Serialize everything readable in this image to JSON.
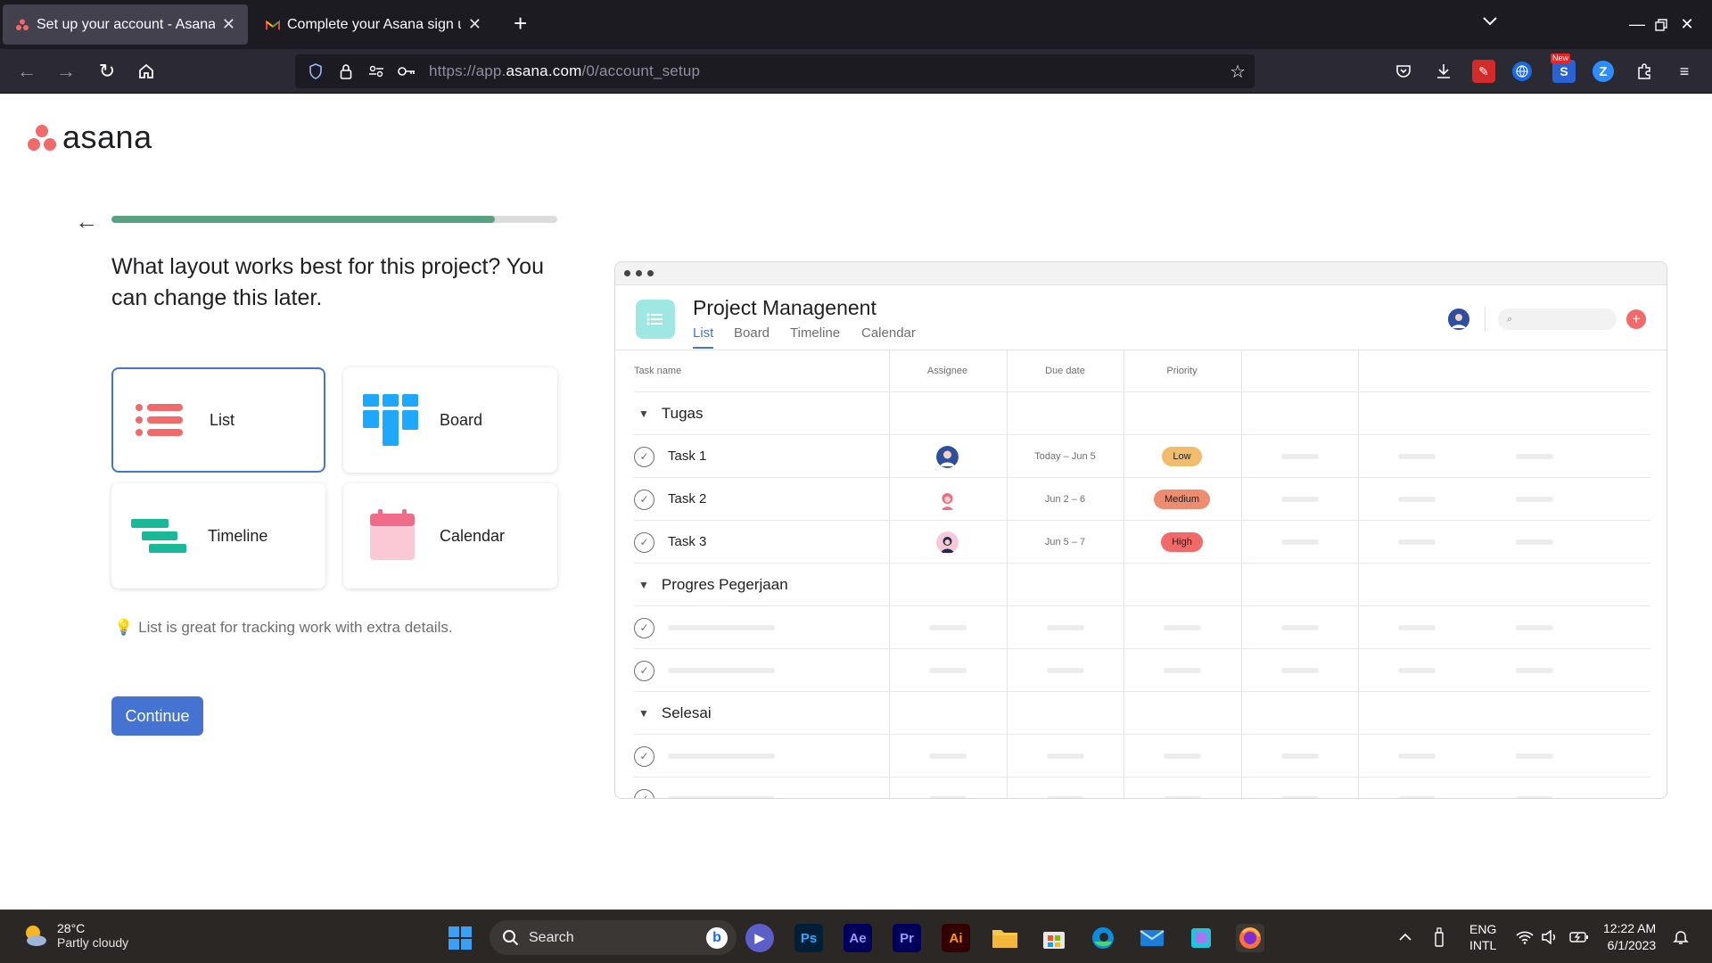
{
  "browser": {
    "tabs": [
      {
        "title": "Set up your account - Asana",
        "active": true
      },
      {
        "title": "Complete your Asana sign up -",
        "active": false
      }
    ],
    "url_prefix": "https://app.",
    "url_host": "asana.com",
    "url_path": "/0/account_setup",
    "extension_badge": "New"
  },
  "page": {
    "logo_text": "asana",
    "progress_fraction": 0.86,
    "question": "What layout works best for this project? You can change this later.",
    "layouts": [
      {
        "label": "List",
        "selected": true,
        "icon": "list-icon"
      },
      {
        "label": "Board",
        "selected": false,
        "icon": "board-icon"
      },
      {
        "label": "Timeline",
        "selected": false,
        "icon": "timeline-icon"
      },
      {
        "label": "Calendar",
        "selected": false,
        "icon": "calendar-icon"
      }
    ],
    "tip": "List is great for tracking work with extra details.",
    "continue_label": "Continue"
  },
  "preview": {
    "project_title": "Project Managenent",
    "tabs": [
      "List",
      "Board",
      "Timeline",
      "Calendar"
    ],
    "active_tab": "List",
    "columns": [
      "Task name",
      "Assignee",
      "Due date",
      "Priority"
    ],
    "sections": [
      {
        "name": "Tugas",
        "tasks": [
          {
            "name": "Task 1",
            "due": "Today – Jun 5",
            "priority": "Low"
          },
          {
            "name": "Task 2",
            "due": "Jun 2 – 6",
            "priority": "Medium"
          },
          {
            "name": "Task 3",
            "due": "Jun 5 – 7",
            "priority": "High"
          }
        ]
      },
      {
        "name": "Progres Pegerjaan"
      },
      {
        "name": "Selesai"
      }
    ]
  },
  "colors": {
    "accent": "#4573d2",
    "progress": "#58a182",
    "brand": "#f06a6a",
    "priority_low": "#f1bd6c",
    "priority_medium": "#ec8d71",
    "priority_high": "#f06a6a"
  },
  "taskbar": {
    "temperature": "28°C",
    "weather": "Partly cloudy",
    "search_label": "Search",
    "language": "ENG",
    "layout": "INTL",
    "time": "12:22 AM",
    "date": "6/1/2023"
  }
}
